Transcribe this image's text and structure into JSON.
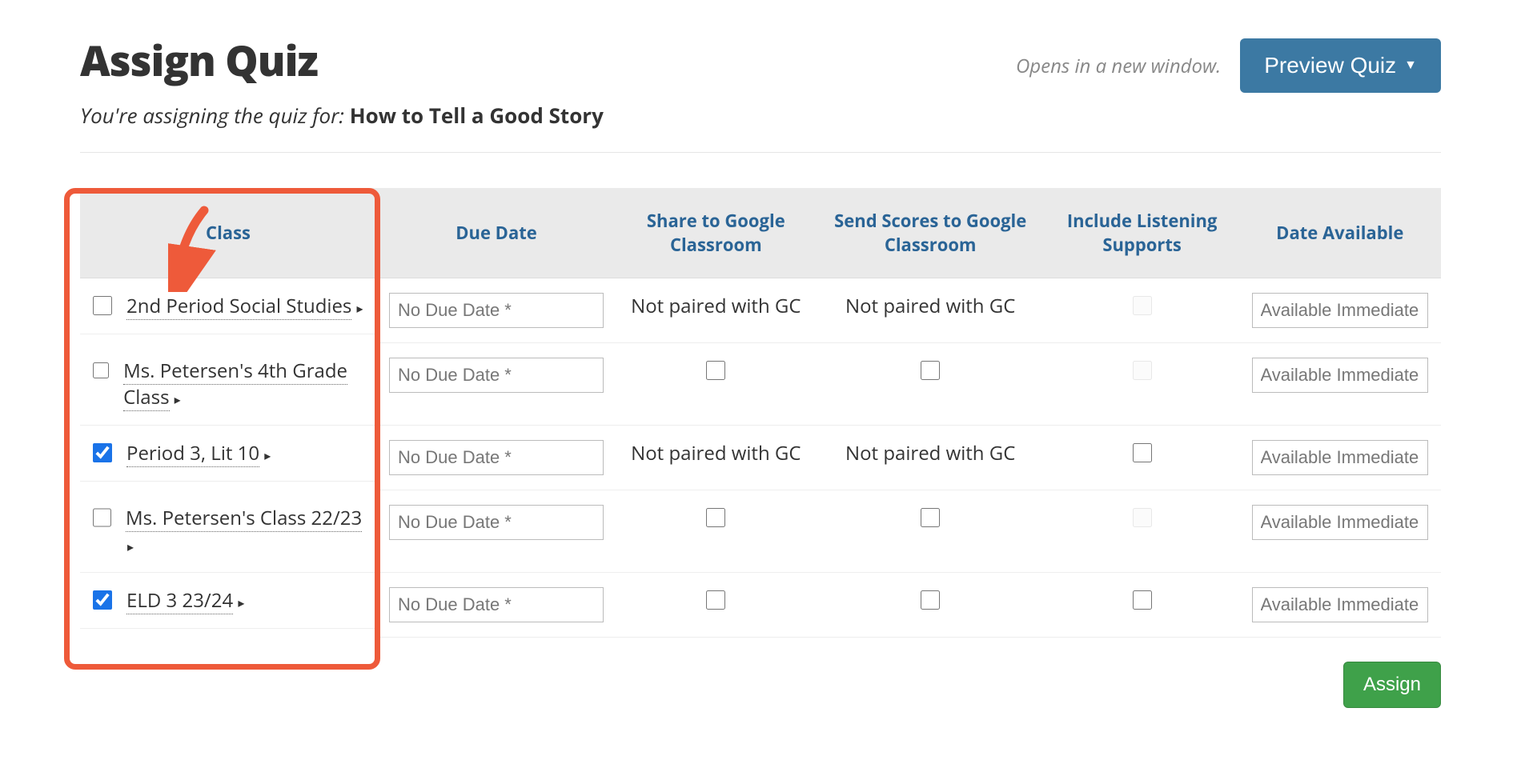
{
  "header": {
    "title": "Assign Quiz",
    "hint": "Opens in a new window.",
    "preview_label": "Preview Quiz",
    "subhead_prefix": "You're assigning the quiz for: ",
    "quiz_title": "How to Tell a Good Story"
  },
  "columns": {
    "class": "Class",
    "due_date": "Due Date",
    "share_gc": "Share to Google Classroom",
    "scores_gc": "Send Scores to Google Classroom",
    "listening": "Include Listening Supports",
    "date_avail": "Date Available"
  },
  "placeholders": {
    "due_date": "No Due Date *",
    "date_avail": "Available Immediately"
  },
  "text": {
    "not_paired": "Not paired with GC"
  },
  "rows": [
    {
      "name": "2nd Period Social Studies",
      "checked": false,
      "share_gc_paired": false,
      "scores_gc_paired": false,
      "listening_enabled": false
    },
    {
      "name": "Ms. Petersen's 4th Grade Class",
      "checked": false,
      "share_gc_paired": true,
      "scores_gc_paired": true,
      "listening_enabled": false
    },
    {
      "name": "Period 3, Lit 10",
      "checked": true,
      "share_gc_paired": false,
      "scores_gc_paired": false,
      "listening_enabled": true
    },
    {
      "name": "Ms. Petersen's Class 22/23",
      "checked": false,
      "share_gc_paired": true,
      "scores_gc_paired": true,
      "listening_enabled": false
    },
    {
      "name": "ELD 3 23/24",
      "checked": true,
      "share_gc_paired": true,
      "scores_gc_paired": true,
      "listening_enabled": true
    }
  ],
  "footer": {
    "assign_label": "Assign"
  }
}
